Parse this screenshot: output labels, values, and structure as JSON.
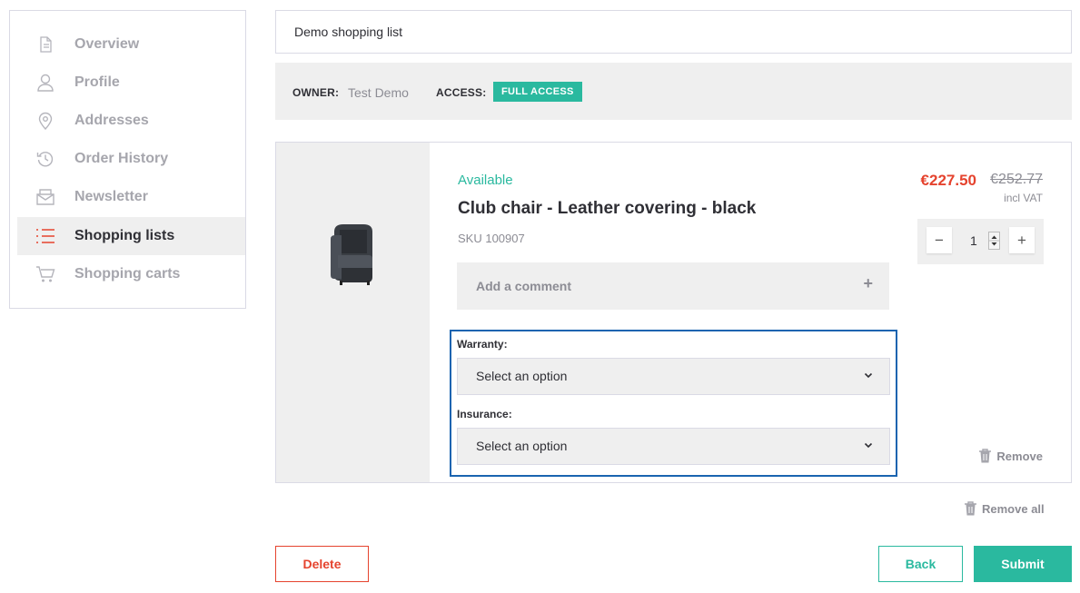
{
  "sidebar": {
    "items": [
      {
        "label": "Overview",
        "icon": "document-icon"
      },
      {
        "label": "Profile",
        "icon": "user-icon"
      },
      {
        "label": "Addresses",
        "icon": "map-pin-icon"
      },
      {
        "label": "Order History",
        "icon": "history-icon"
      },
      {
        "label": "Newsletter",
        "icon": "envelope-icon"
      },
      {
        "label": "Shopping lists",
        "icon": "list-icon",
        "active": true
      },
      {
        "label": "Shopping carts",
        "icon": "cart-icon"
      }
    ]
  },
  "list": {
    "title": "Demo shopping list",
    "owner_label": "OWNER:",
    "owner_value": "Test Demo",
    "access_label": "ACCESS:",
    "access_badge": "FULL ACCESS"
  },
  "item": {
    "availability": "Available",
    "name": "Club chair - Leather covering - black",
    "sku": "SKU 100907",
    "comment_label": "Add a comment",
    "comment_plus": "+",
    "price": "€227.50",
    "price_old": "€252.77",
    "vat_note": "incl VAT",
    "quantity": "1",
    "qty_minus": "−",
    "qty_plus": "+",
    "warranty_label": "Warranty:",
    "warranty_value": "Select an option",
    "insurance_label": "Insurance:",
    "insurance_value": "Select an option",
    "remove_label": "Remove"
  },
  "actions": {
    "remove_all": "Remove all",
    "delete": "Delete",
    "back": "Back",
    "submit": "Submit"
  },
  "colors": {
    "accent": "#2ab99f",
    "danger": "#e5432e",
    "highlight_border": "#1a64b0"
  }
}
